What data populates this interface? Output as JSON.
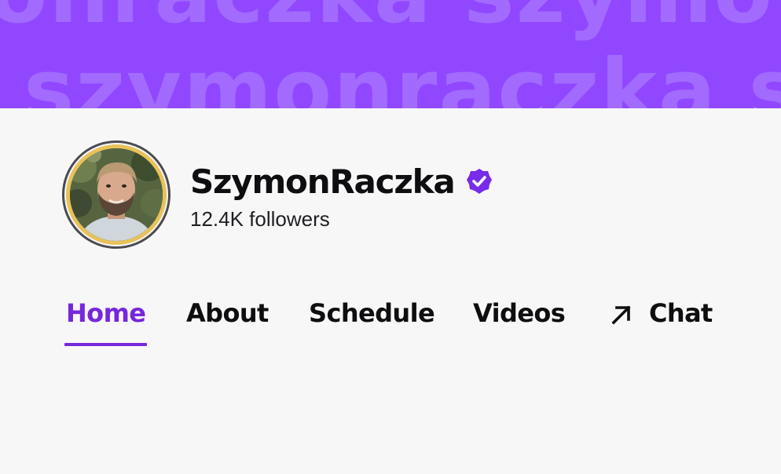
{
  "banner": {
    "line1": "onraczka szymo",
    "line2": "szymonraczka s",
    "background_color": "#9147ff"
  },
  "channel": {
    "name": "SzymonRaczka",
    "followers": "12.4K followers",
    "verified_icon": "verified-badge-icon"
  },
  "tabs": [
    {
      "label": "Home",
      "active": true
    },
    {
      "label": "About",
      "active": false
    },
    {
      "label": "Schedule",
      "active": false
    },
    {
      "label": "Videos",
      "active": false
    },
    {
      "label": "Chat",
      "active": false,
      "icon": "arrow-up-right-icon"
    }
  ],
  "colors": {
    "accent": "#7727dc",
    "verified": "#772ce8",
    "avatar_ring": "#e8c25a"
  }
}
